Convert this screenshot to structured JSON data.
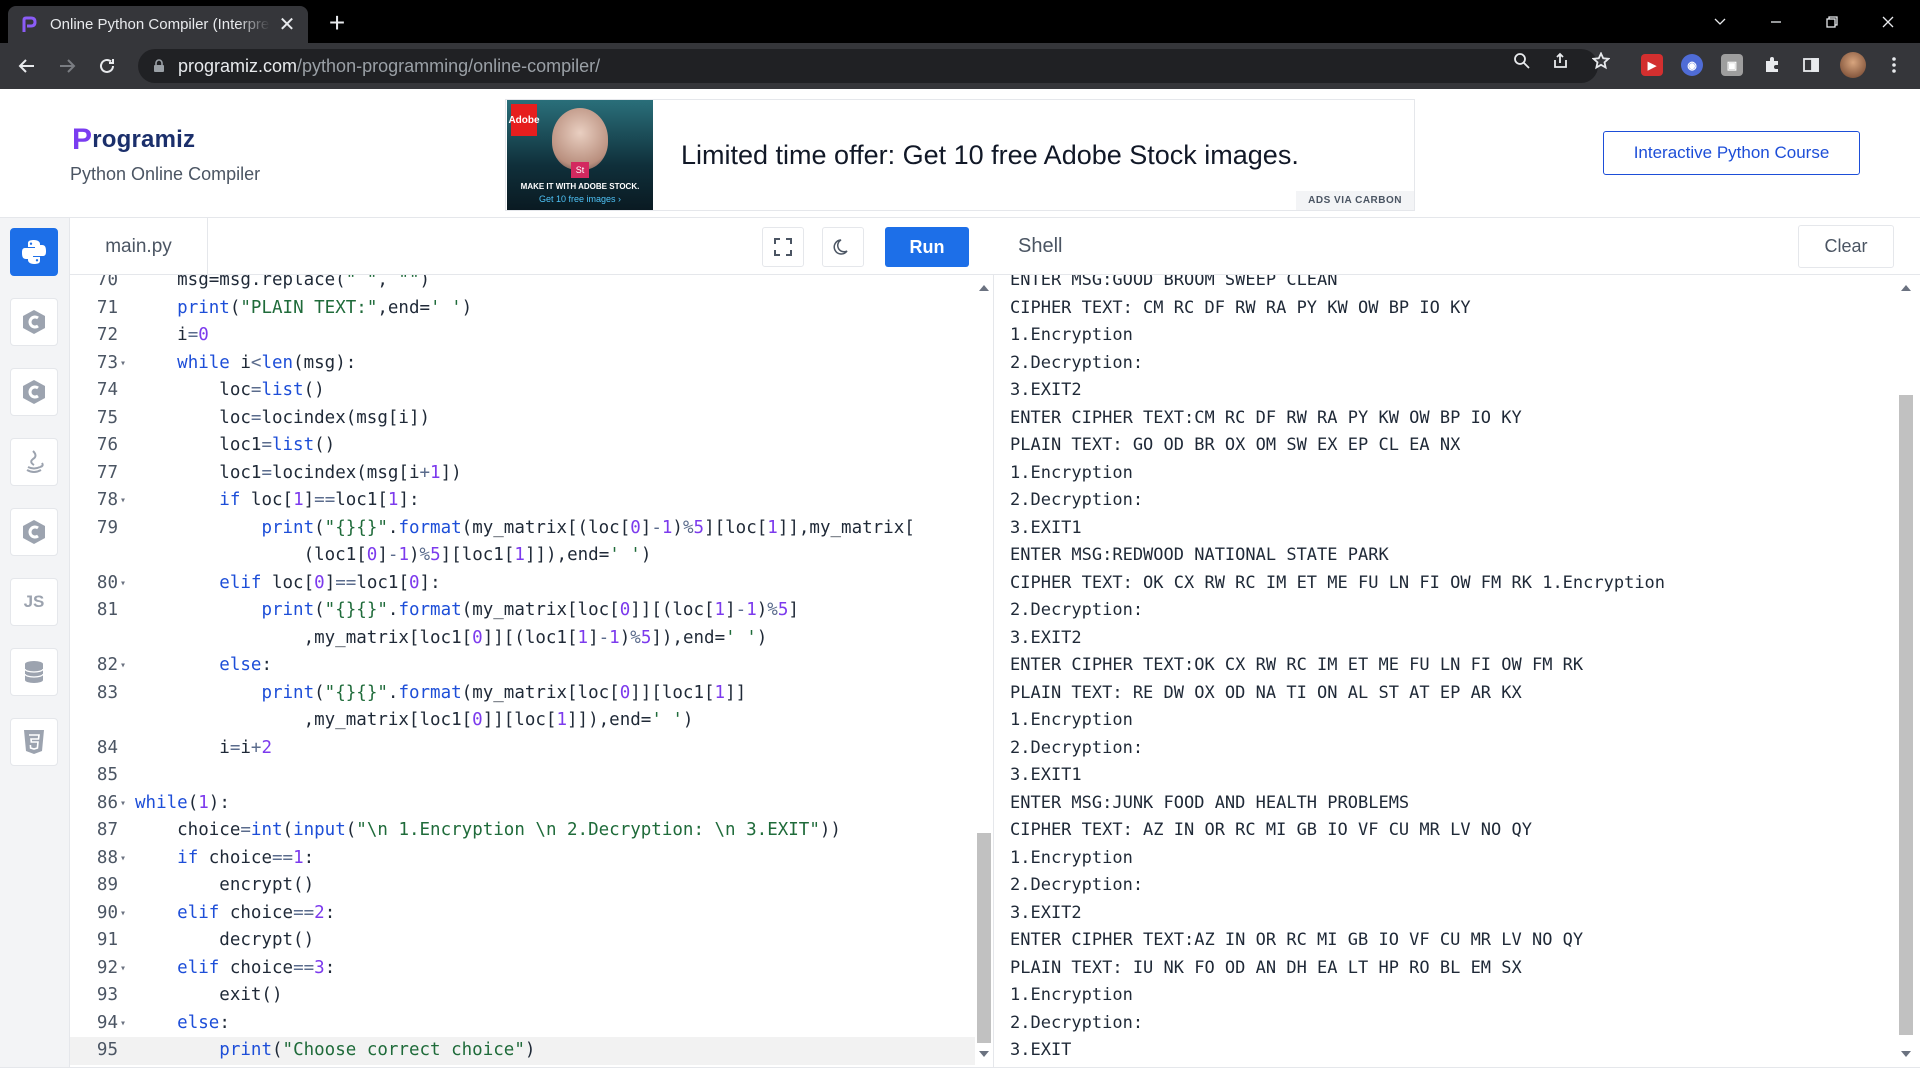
{
  "browser": {
    "tab_title": "Online Python Compiler (Interpreter)",
    "url_host": "programiz.com",
    "url_path": "/python-programming/online-compiler/"
  },
  "header": {
    "logo_text": "rogramiz",
    "logo_mark": "P",
    "subtitle": "Python Online Compiler",
    "course_button": "Interactive Python Course"
  },
  "ad": {
    "text": "Limited time offer: Get 10 free Adobe Stock images.",
    "via": "ADS VIA CARBON",
    "img_caption1": "MAKE IT WITH ADOBE STOCK.",
    "img_caption2": "Get 10 free images ›",
    "img_brand": "Adobe",
    "img_st": "St"
  },
  "rail": {
    "js_label": "JS"
  },
  "editor": {
    "file_name": "main.py",
    "run_label": "Run",
    "lines": [
      {
        "n": "70",
        "fold": "",
        "html": "    msg=msg.replace(<span class=\"s\">\" \"</span>, <span class=\"s\">\"\"</span>)"
      },
      {
        "n": "71",
        "fold": "",
        "html": "    <span class=\"k\">print</span>(<span class=\"s\">\"PLAIN TEXT:\"</span>,end=<span class=\"s\">' '</span>)"
      },
      {
        "n": "72",
        "fold": "",
        "html": "    i<span class=\"o\">=</span><span class=\"n\">0</span>"
      },
      {
        "n": "73",
        "fold": "▾",
        "html": "    <span class=\"k\">while</span> i<span class=\"o\">&lt;</span><span class=\"k\">len</span>(msg):"
      },
      {
        "n": "74",
        "fold": "",
        "html": "        loc<span class=\"o\">=</span><span class=\"k\">list</span>()"
      },
      {
        "n": "75",
        "fold": "",
        "html": "        loc<span class=\"o\">=</span>locindex(msg[i])"
      },
      {
        "n": "76",
        "fold": "",
        "html": "        loc1<span class=\"o\">=</span><span class=\"k\">list</span>()"
      },
      {
        "n": "77",
        "fold": "",
        "html": "        loc1<span class=\"o\">=</span>locindex(msg[i<span class=\"o\">+</span><span class=\"n\">1</span>])"
      },
      {
        "n": "78",
        "fold": "▾",
        "html": "        <span class=\"k\">if</span> loc[<span class=\"n\">1</span>]<span class=\"o\">==</span>loc1[<span class=\"n\">1</span>]:"
      },
      {
        "n": "79",
        "fold": "",
        "html": "            <span class=\"k\">print</span>(<span class=\"s\">\"{}{}\"</span>.<span class=\"k\">format</span>(my_matrix[(loc[<span class=\"n\">0</span>]<span class=\"o\">-</span><span class=\"n\">1</span>)<span class=\"o\">%</span><span class=\"n\">5</span>][loc[<span class=\"n\">1</span>]],my_matrix["
      },
      {
        "n": "",
        "fold": "",
        "html": "                (loc1[<span class=\"n\">0</span>]<span class=\"o\">-</span><span class=\"n\">1</span>)<span class=\"o\">%</span><span class=\"n\">5</span>][loc1[<span class=\"n\">1</span>]]),end=<span class=\"s\">' '</span>)"
      },
      {
        "n": "80",
        "fold": "▾",
        "html": "        <span class=\"k\">elif</span> loc[<span class=\"n\">0</span>]<span class=\"o\">==</span>loc1[<span class=\"n\">0</span>]:"
      },
      {
        "n": "81",
        "fold": "",
        "html": "            <span class=\"k\">print</span>(<span class=\"s\">\"{}{}\"</span>.<span class=\"k\">format</span>(my_matrix[loc[<span class=\"n\">0</span>]][(loc[<span class=\"n\">1</span>]<span class=\"o\">-</span><span class=\"n\">1</span>)<span class=\"o\">%</span><span class=\"n\">5</span>]"
      },
      {
        "n": "",
        "fold": "",
        "html": "                ,my_matrix[loc1[<span class=\"n\">0</span>]][(loc1[<span class=\"n\">1</span>]<span class=\"o\">-</span><span class=\"n\">1</span>)<span class=\"o\">%</span><span class=\"n\">5</span>]),end=<span class=\"s\">' '</span>)"
      },
      {
        "n": "82",
        "fold": "▾",
        "html": "        <span class=\"k\">else</span>:"
      },
      {
        "n": "83",
        "fold": "",
        "html": "            <span class=\"k\">print</span>(<span class=\"s\">\"{}{}\"</span>.<span class=\"k\">format</span>(my_matrix[loc[<span class=\"n\">0</span>]][loc1[<span class=\"n\">1</span>]]"
      },
      {
        "n": "",
        "fold": "",
        "html": "                ,my_matrix[loc1[<span class=\"n\">0</span>]][loc[<span class=\"n\">1</span>]]),end=<span class=\"s\">' '</span>)"
      },
      {
        "n": "84",
        "fold": "",
        "html": "        i<span class=\"o\">=</span>i<span class=\"o\">+</span><span class=\"n\">2</span>"
      },
      {
        "n": "85",
        "fold": "",
        "html": ""
      },
      {
        "n": "86",
        "fold": "▾",
        "html": "<span class=\"k\">while</span>(<span class=\"n\">1</span>):"
      },
      {
        "n": "87",
        "fold": "",
        "html": "    choice<span class=\"o\">=</span><span class=\"k\">int</span>(<span class=\"k\">input</span>(<span class=\"s\">\"\\n 1.Encryption \\n 2.Decryption: \\n 3.EXIT\"</span>))"
      },
      {
        "n": "88",
        "fold": "▾",
        "html": "    <span class=\"k\">if</span> choice<span class=\"o\">==</span><span class=\"n\">1</span>:"
      },
      {
        "n": "89",
        "fold": "",
        "html": "        encrypt()"
      },
      {
        "n": "90",
        "fold": "▾",
        "html": "    <span class=\"k\">elif</span> choice<span class=\"o\">==</span><span class=\"n\">2</span>:"
      },
      {
        "n": "91",
        "fold": "",
        "html": "        decrypt()"
      },
      {
        "n": "92",
        "fold": "▾",
        "html": "    <span class=\"k\">elif</span> choice<span class=\"o\">==</span><span class=\"n\">3</span>:"
      },
      {
        "n": "93",
        "fold": "",
        "html": "        exit()"
      },
      {
        "n": "94",
        "fold": "▾",
        "html": "    <span class=\"k\">else</span>:"
      },
      {
        "n": "95",
        "fold": "",
        "html": "        <span class=\"k\">print</span>(<span class=\"s\">\"Choose correct choice\"</span>)"
      }
    ]
  },
  "shell": {
    "title": "Shell",
    "clear_label": "Clear",
    "lines": [
      "ENTER MSG:GOOD BROOM SWEEP CLEAN",
      "CIPHER TEXT: CM RC DF RW RA PY KW OW BP IO KY",
      "1.Encryption",
      "2.Decryption:",
      "3.EXIT2",
      "ENTER CIPHER TEXT:CM RC DF RW RA PY KW OW BP IO KY",
      "PLAIN TEXT: GO OD BR OX OM SW EX EP CL EA NX",
      "1.Encryption",
      "2.Decryption:",
      "3.EXIT1",
      "ENTER MSG:REDWOOD NATIONAL STATE PARK",
      "CIPHER TEXT: OK CX RW RC IM ET ME FU LN FI OW FM RK 1.Encryption",
      "2.Decryption:",
      "3.EXIT2",
      "ENTER CIPHER TEXT:OK CX RW RC IM ET ME FU LN FI OW FM RK",
      "PLAIN TEXT: RE DW OX OD NA TI ON AL ST AT EP AR KX",
      "1.Encryption",
      "2.Decryption:",
      "3.EXIT1",
      "ENTER MSG:JUNK FOOD AND HEALTH PROBLEMS",
      "CIPHER TEXT: AZ IN OR RC MI GB IO VF CU MR LV NO QY",
      "1.Encryption",
      "2.Decryption:",
      "3.EXIT2",
      "ENTER CIPHER TEXT:AZ IN OR RC MI GB IO VF CU MR LV NO QY",
      "PLAIN TEXT: IU NK FO OD AN DH EA LT HP RO BL EM SX",
      "1.Encryption",
      "2.Decryption:",
      "3.EXIT"
    ]
  },
  "colors": {
    "accent": "#1d6fe8",
    "brand": "#1b2f6b",
    "keyword": "#1d4ed8",
    "string": "#1f6b3a"
  }
}
